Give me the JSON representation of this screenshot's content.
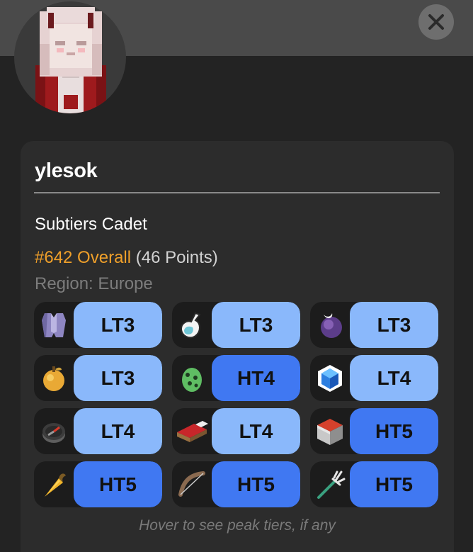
{
  "player": {
    "username": "ylesok",
    "title": "Subtiers Cadet",
    "rank": "#642 Overall",
    "points": "(46 Points)",
    "region": "Region: Europe"
  },
  "tiers": [
    {
      "icon": "armor-chestplate-icon",
      "tier": "LT3",
      "color": "#8ab8fb"
    },
    {
      "icon": "potion-icon",
      "tier": "LT3",
      "color": "#8ab8fb"
    },
    {
      "icon": "purple-orb-icon",
      "tier": "LT3",
      "color": "#8ab8fb"
    },
    {
      "icon": "golden-fruit-icon",
      "tier": "LT3",
      "color": "#8ab8fb"
    },
    {
      "icon": "spawn-egg-icon",
      "tier": "HT4",
      "color": "#4078f2"
    },
    {
      "icon": "blue-cube-icon",
      "tier": "LT4",
      "color": "#8ab8fb"
    },
    {
      "icon": "compass-icon",
      "tier": "LT4",
      "color": "#8ab8fb"
    },
    {
      "icon": "bed-icon",
      "tier": "LT4",
      "color": "#8ab8fb"
    },
    {
      "icon": "tnt-block-icon",
      "tier": "HT5",
      "color": "#4078f2"
    },
    {
      "icon": "golden-carrot-icon",
      "tier": "HT5",
      "color": "#4078f2"
    },
    {
      "icon": "bow-icon",
      "tier": "HT5",
      "color": "#4078f2"
    },
    {
      "icon": "trident-icon",
      "tier": "HT5",
      "color": "#4078f2"
    }
  ],
  "footer": {
    "hint": "Hover to see peak tiers, if any"
  },
  "colors": {
    "overall_accent": "#f0a02a",
    "tier_low": "#8ab8fb",
    "tier_high": "#4078f2"
  }
}
